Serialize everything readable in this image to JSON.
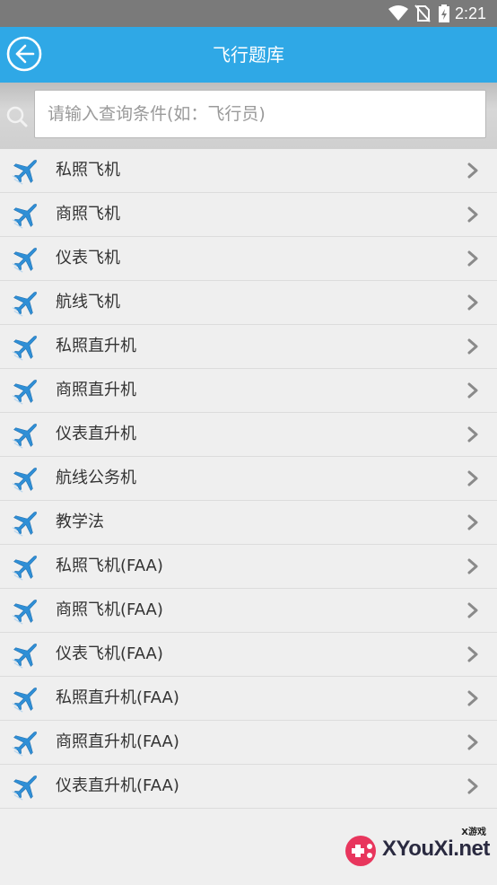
{
  "status_bar": {
    "time": "2:21"
  },
  "header": {
    "title": "飞行题库"
  },
  "search": {
    "placeholder": "请输入查询条件(如：飞行员)"
  },
  "items": [
    {
      "label": "私照飞机"
    },
    {
      "label": "商照飞机"
    },
    {
      "label": "仪表飞机"
    },
    {
      "label": "航线飞机"
    },
    {
      "label": "私照直升机"
    },
    {
      "label": "商照直升机"
    },
    {
      "label": "仪表直升机"
    },
    {
      "label": "航线公务机"
    },
    {
      "label": "教学法"
    },
    {
      "label": "私照飞机(FAA)"
    },
    {
      "label": "商照飞机(FAA)"
    },
    {
      "label": "仪表飞机(FAA)"
    },
    {
      "label": "私照直升机(FAA)"
    },
    {
      "label": "商照直升机(FAA)"
    },
    {
      "label": "仪表直升机(FAA)"
    }
  ],
  "watermark": {
    "brand": "XYouXi.net",
    "small": "X游戏"
  },
  "colors": {
    "accent": "#2fa8e6",
    "status_bar": "#7a7a7a",
    "plane_icon": "#2f8fd6",
    "background": "#efefef"
  },
  "icons": {
    "back": "back-arrow-circle-icon",
    "search": "search-icon",
    "item": "airplane-icon",
    "chevron": "chevron-right-icon"
  }
}
